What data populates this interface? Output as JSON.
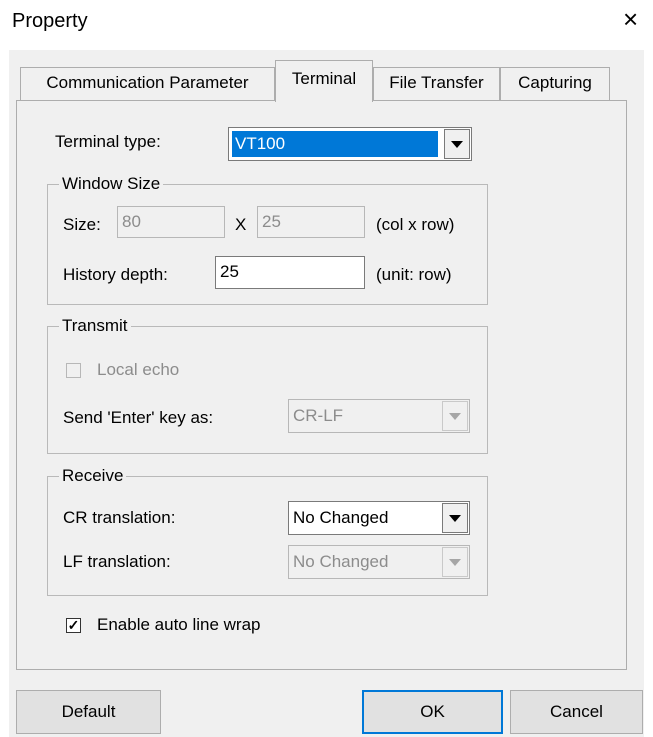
{
  "window": {
    "title": "Property",
    "close_glyph": "×"
  },
  "tabs": [
    {
      "label": "Communication Parameter",
      "active": false
    },
    {
      "label": "Terminal",
      "active": true
    },
    {
      "label": "File Transfer",
      "active": false
    },
    {
      "label": "Capturing",
      "active": false
    }
  ],
  "terminal": {
    "type_label": "Terminal type:",
    "type_value": "VT100",
    "window_size": {
      "legend": "Window Size",
      "size_label": "Size:",
      "cols_value": "80",
      "x_label": "X",
      "rows_value": "25",
      "unit_label": "(col x row)",
      "history_label": "History depth:",
      "history_value": "25",
      "history_unit": "(unit: row)"
    },
    "transmit": {
      "legend": "Transmit",
      "local_echo_label": "Local echo",
      "local_echo_checked": false,
      "send_enter_label": "Send 'Enter' key  as:",
      "send_enter_value": "CR-LF"
    },
    "receive": {
      "legend": "Receive",
      "cr_label": "CR translation:",
      "cr_value": "No Changed",
      "lf_label": "LF translation:",
      "lf_value": "No Changed"
    },
    "auto_wrap_label": "Enable auto line wrap",
    "auto_wrap_checked": true,
    "check_glyph": "✓"
  },
  "buttons": {
    "default_label": "Default",
    "ok_label": "OK",
    "cancel_label": "Cancel"
  },
  "colors": {
    "selection": "#0078d7",
    "dialog_bg": "#f0f0f0"
  }
}
